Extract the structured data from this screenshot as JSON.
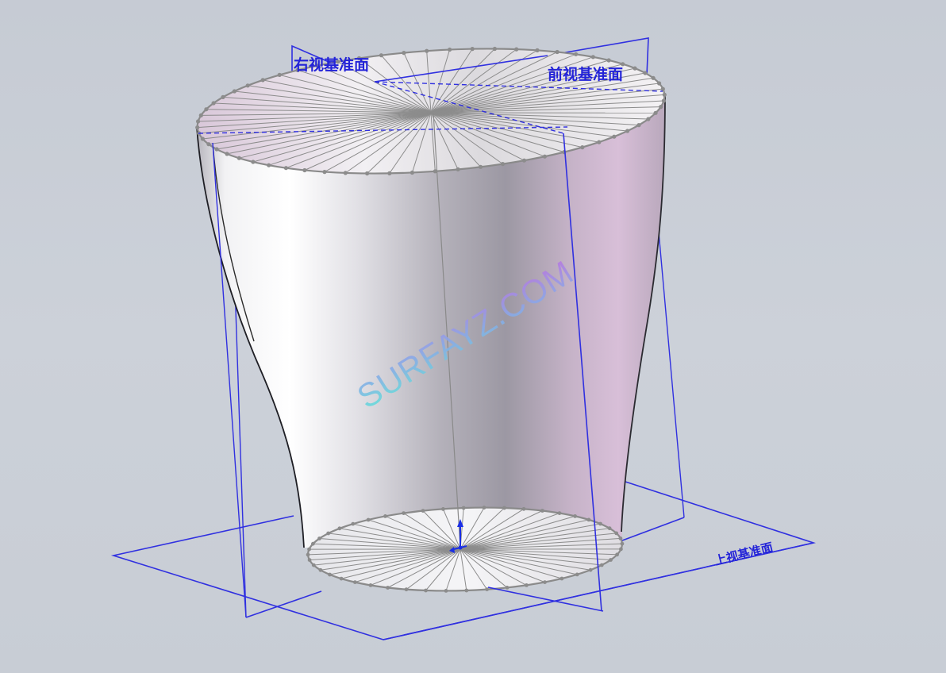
{
  "viewport": {
    "background": "#c9ced6"
  },
  "planes": {
    "right_plane_label": "右视基准面",
    "front_plane_label": "前视基准面",
    "top_plane_label": "上视基准面",
    "plane_color": "#3030e0"
  },
  "model": {
    "type": "lofted surface",
    "edge_color": "#8a8a8a",
    "vertex_color": "#8c8c8c",
    "surface_highlight": "#ffffff",
    "surface_shadow": "#8e8c95",
    "surface_tint": "#d7bcd6"
  },
  "origin": {
    "axis_color": "#1a2ee6",
    "icon": "origin-triad-icon"
  },
  "watermark": {
    "text": "SURFAYZ.COM",
    "gradient_start": "#5ee8d8",
    "gradient_end": "#c070e0"
  }
}
